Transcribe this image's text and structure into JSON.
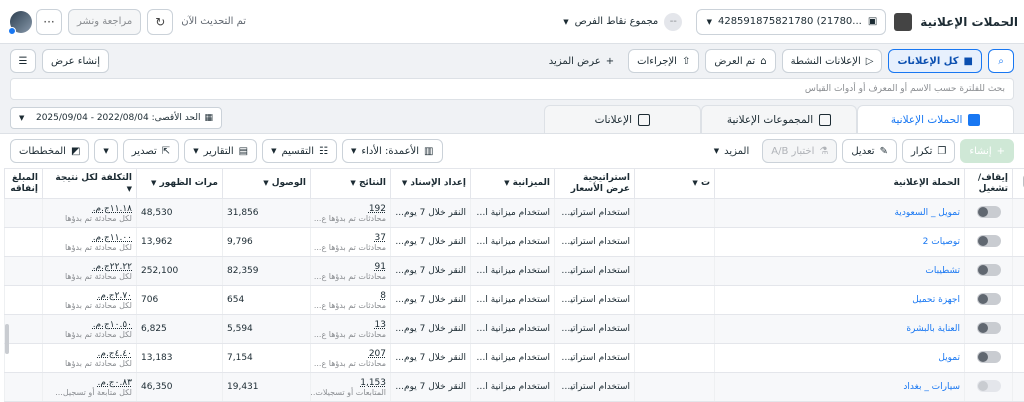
{
  "header": {
    "title": "الحملات الإعلانية",
    "account": "428591875821780 (21780...",
    "opportunities": "مجموع نقاط الفرص",
    "opportunity_score": "--",
    "updated": "تم التحديث الآن",
    "review_label": "مراجعة ونشر",
    "more_label": "···"
  },
  "toolbar_top": {
    "all_ads": "كل الإعلانات",
    "active_ads": "الإعلانات النشطة",
    "displayed": "تم العرض",
    "actions": "الإجراءات",
    "show_more": "عرض المزيد",
    "create_view": "إنشاء عرض"
  },
  "search": {
    "placeholder": "بحث للفلترة حسب الاسم أو المعرف أو أدوات القياس"
  },
  "date_range": {
    "label": "الحد الأقصى: 2022/08/04 - 2025/09/04"
  },
  "tabs": [
    "الحملات الإعلانية",
    "المجموعات الإعلانية",
    "الإعلانات"
  ],
  "table_toolbar": {
    "create": "إنشاء",
    "duplicate": "تكرار",
    "edit": "تعديل",
    "ab_test": "اختبار A/B",
    "more": "المزيد",
    "columns": "الأعمدة: الأداء",
    "breakdown": "التقسيم",
    "reports": "التقارير",
    "export": "تصدير",
    "charts": "المخططات"
  },
  "columns": [
    "إيقاف/تشغيل",
    "الحملة الإعلانية",
    "ت",
    "استراتيجية عرض الأسعار",
    "الميزانية",
    "إعداد الإسناد",
    "النتائج",
    "الوصول",
    "مرات الظهور",
    "التكلفة لكل نتيجة",
    "المبلغ إنفاقه"
  ],
  "rows": [
    {
      "on": true,
      "name": "تمويل _ السعودية",
      "strategy": "استخدام استراتيجية...",
      "budget": "استخدام ميزانية ال...",
      "attribution": "النقر خلال 7 يوم...",
      "results": "192",
      "results_sub": "محادثات تم بدؤها ع...",
      "reach": "31,856",
      "impressions": "48,530",
      "cpr": "١١.١٨ج.م.",
      "cpr_sub": "لكل محادثة تم بدؤها",
      "spent": ""
    },
    {
      "on": true,
      "name": "توصيات 2",
      "strategy": "استخدام استراتيجية...",
      "budget": "استخدام ميزانية ال...",
      "attribution": "النقر خلال 7 يوم...",
      "results": "37",
      "results_sub": "محادثات تم بدؤها ع...",
      "reach": "9,796",
      "impressions": "13,962",
      "cpr": "١١.٠٠ج.م.",
      "cpr_sub": "لكل محادثة تم بدؤها",
      "spent": ""
    },
    {
      "on": true,
      "name": "تشطيبات",
      "strategy": "استخدام استراتيجية...",
      "budget": "استخدام ميزانية ال...",
      "attribution": "النقر خلال 7 يوم...",
      "results": "91",
      "results_sub": "محادثات تم بدؤها ع...",
      "reach": "82,359",
      "impressions": "252,100",
      "cpr": "٢٢.٢٢ج.م.",
      "cpr_sub": "لكل محادثة تم بدؤها",
      "spent": ""
    },
    {
      "on": true,
      "name": "اجهزة تحميل",
      "strategy": "استخدام استراتيجية...",
      "budget": "استخدام ميزانية ال...",
      "attribution": "النقر خلال 7 يوم...",
      "results": "8",
      "results_sub": "محادثات تم بدؤها ع...",
      "reach": "654",
      "impressions": "706",
      "cpr": "٢.٧٠ج.م.",
      "cpr_sub": "لكل محادثة تم بدؤها",
      "spent": ""
    },
    {
      "on": true,
      "name": "العناية بالبشرة",
      "strategy": "استخدام استراتيجية...",
      "budget": "استخدام ميزانية ال...",
      "attribution": "النقر خلال 7 يوم...",
      "results": "13",
      "results_sub": "محادثات تم بدؤها ع...",
      "reach": "5,594",
      "impressions": "6,825",
      "cpr": "١٠.٥٠ج.م.",
      "cpr_sub": "لكل محادثة تم بدؤها",
      "spent": ""
    },
    {
      "on": true,
      "name": "تمويل",
      "strategy": "استخدام استراتيجية...",
      "budget": "استخدام ميزانية ال...",
      "attribution": "النقر خلال 7 يوم...",
      "results": "207",
      "results_sub": "محادثات تم بدؤها ع...",
      "reach": "7,154",
      "impressions": "13,183",
      "cpr": "٤.٤٠ج.م.",
      "cpr_sub": "لكل محادثة تم بدؤها",
      "spent": ""
    },
    {
      "on": false,
      "name": "سيارات _ بغداد",
      "strategy": "استخدام استراتيجية...",
      "budget": "استخدام ميزانية ال...",
      "attribution": "النقر خلال 7 يوم...",
      "results": "1,153",
      "results_sub": "المتابعات أو تسجيلات...",
      "reach": "19,431",
      "impressions": "46,350",
      "cpr": "٠.٨٣ج.م.",
      "cpr_sub": "لكل متابعة أو تسجيل...",
      "spent": ""
    }
  ]
}
